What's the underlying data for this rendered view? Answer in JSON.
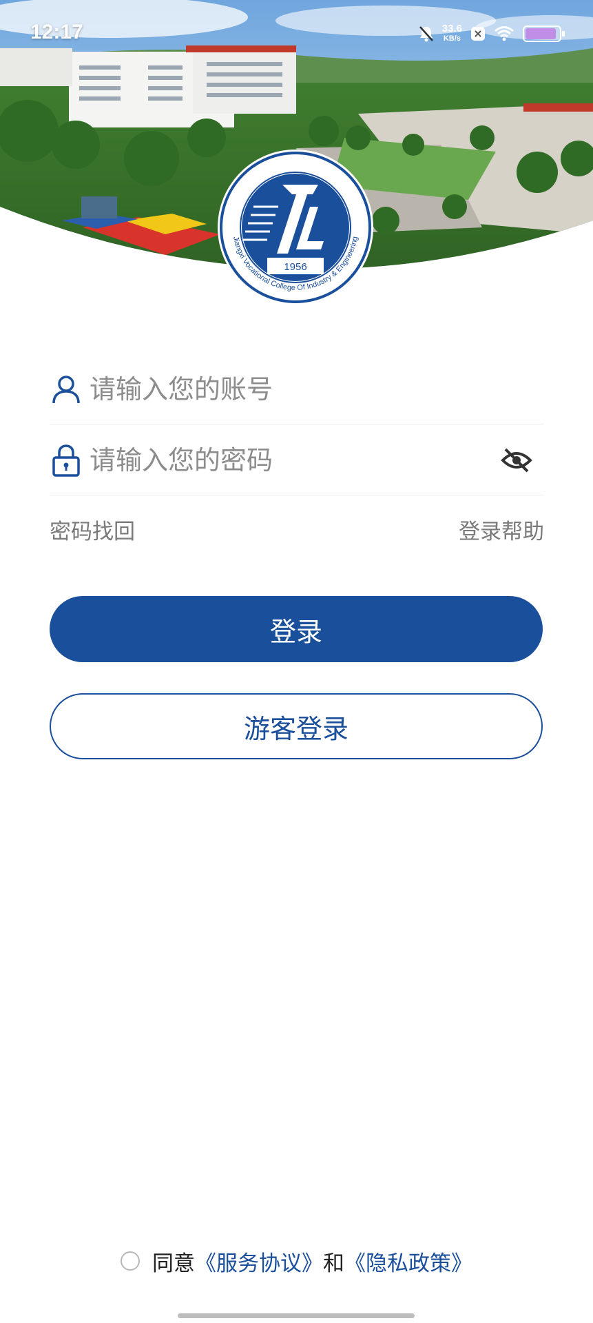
{
  "status_bar": {
    "time": "12:17",
    "net_speed_value": "33.6",
    "net_speed_unit": "KB/s",
    "icons": [
      "bell-off-icon",
      "app-notification-icon",
      "wifi-icon",
      "battery-icon"
    ]
  },
  "hero": {
    "logo_year": "1956",
    "logo_text_en": "Jiangxi Vocational College Of Industry & Engineering"
  },
  "form": {
    "account_placeholder": "请输入您的账号",
    "password_placeholder": "请输入您的密码",
    "icons": [
      "user-icon",
      "lock-icon",
      "eye-off-icon"
    ]
  },
  "links": {
    "recover_password": "密码找回",
    "login_help": "登录帮助"
  },
  "buttons": {
    "login": "登录",
    "guest_login": "游客登录"
  },
  "agreement": {
    "agree": "同意",
    "service": "《服务协议》",
    "and": "和",
    "privacy": "《隐私政策》"
  },
  "colors": {
    "primary": "#1a4f9c",
    "placeholder": "#8c8c8c",
    "link_gray": "#7a7a7a"
  }
}
